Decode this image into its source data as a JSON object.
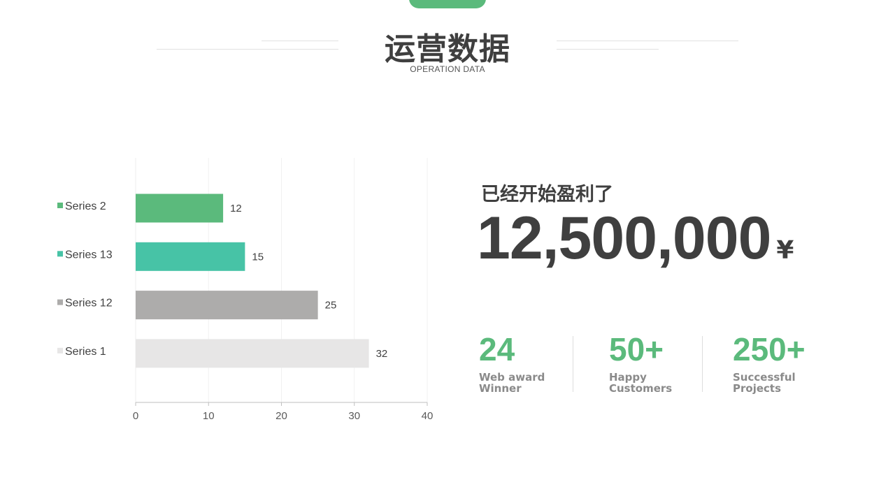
{
  "header": {
    "title": "运营数据",
    "subtitle": "OPERATION DATA"
  },
  "colors": {
    "accent": "#5bba7c",
    "text_dark": "#3f3f3f",
    "text_gray": "#8a8a8a"
  },
  "profit": {
    "label": "已经开始盈利了",
    "value": "12,500,000",
    "currency": "¥"
  },
  "stats": [
    {
      "number": "24",
      "label_line1": "Web award",
      "label_line2": "Winner"
    },
    {
      "number": "50+",
      "label_line1": "Happy",
      "label_line2": "Customers"
    },
    {
      "number": "250+",
      "label_line1": "Successful",
      "label_line2": "Projects"
    }
  ],
  "chart_data": {
    "type": "bar",
    "orientation": "horizontal",
    "categories": [
      "Series 2",
      "Series 13",
      "Series 12",
      "Series 1"
    ],
    "values": [
      12,
      15,
      25,
      32
    ],
    "colors": [
      "#5bba7c",
      "#47c3a6",
      "#adacab",
      "#e7e6e6"
    ],
    "xlim": [
      0,
      40
    ],
    "xticks": [
      0,
      10,
      20,
      30,
      40
    ],
    "data_labels": true,
    "grid": "vertical"
  }
}
